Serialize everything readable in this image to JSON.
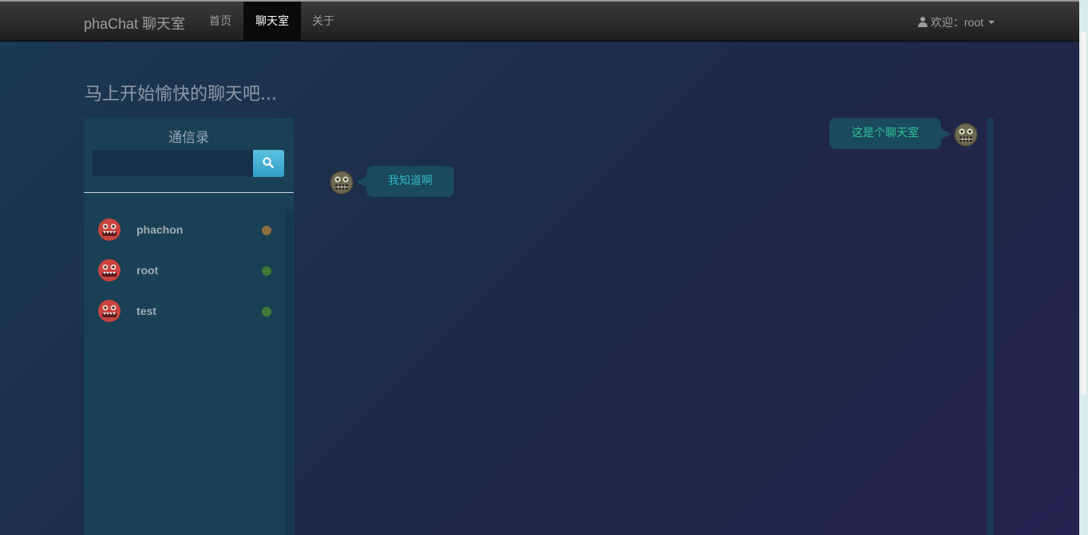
{
  "navbar": {
    "brand": "phaChat 聊天室",
    "items": [
      {
        "label": "首页",
        "active": false
      },
      {
        "label": "聊天室",
        "active": true
      },
      {
        "label": "关于",
        "active": false
      }
    ],
    "user_greeting": "欢迎：root"
  },
  "page": {
    "heading": "马上开始愉快的聊天吧..."
  },
  "contacts": {
    "title": "通信录",
    "search": {
      "value": "",
      "placeholder": ""
    },
    "items": [
      {
        "name": "phachon",
        "status_color": "#8a6e3c"
      },
      {
        "name": "root",
        "status_color": "#3f7a33"
      },
      {
        "name": "test",
        "status_color": "#3f7a33"
      }
    ]
  },
  "messages": [
    {
      "text": "这是个聊天室",
      "side": "right",
      "text_color": "#2ec499"
    },
    {
      "text": "我知道啊",
      "side": "left",
      "text_color": "#2fb7c8"
    }
  ]
}
